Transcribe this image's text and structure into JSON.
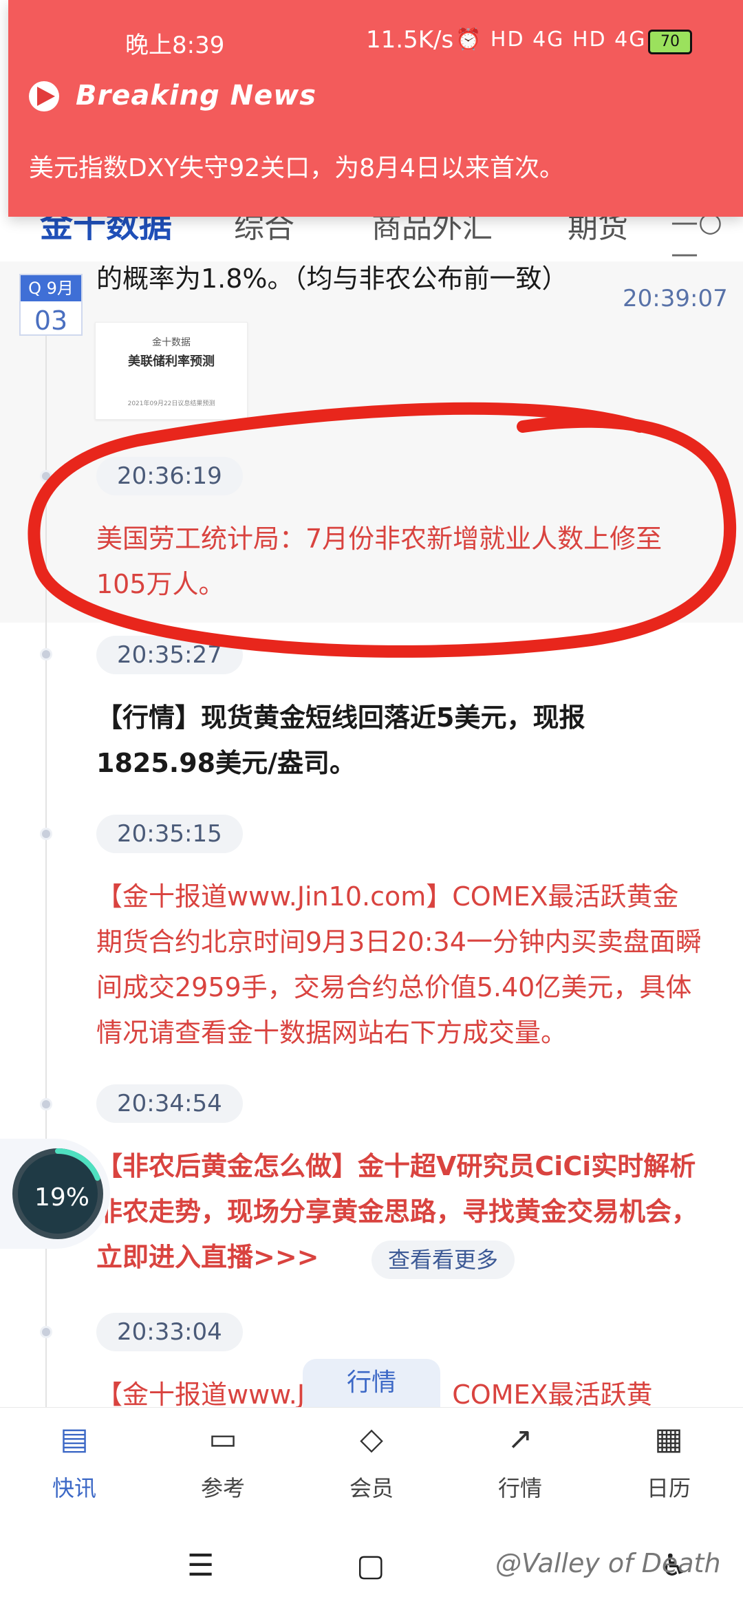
{
  "status_bar": {
    "time": "晚上8:39",
    "net_speed": "11.5K/s",
    "icons": "⏰ HD 4G HD 4G",
    "battery": "70"
  },
  "breaking_news": {
    "title": "Breaking News",
    "text": "美元指数DXY失守92关口，为8月4日以来首次。"
  },
  "top_nav": {
    "brand": "金十数据",
    "tabs": [
      "综合",
      "商品外汇",
      "期货"
    ],
    "more": "—○—"
  },
  "date_badge": {
    "month": "Q 9月",
    "day": "03"
  },
  "feed": [
    {
      "time": "20:39:07",
      "text": "的概率为1.8%。（均与非农公布前一致）",
      "thumbnail": {
        "line1": "金十数据",
        "line2": "美联储利率预测",
        "line3": "2021年09月22日议息结果预测"
      }
    },
    {
      "time": "20:36:19",
      "text": "美国劳工统计局：7月份非农新增就业人数上修至105万人。"
    },
    {
      "time": "20:35:27",
      "text": "【行情】现货黄金短线回落近5美元，现报1825.98美元/盎司。"
    },
    {
      "time": "20:35:15",
      "text": "【金十报道www.Jin10.com】COMEX最活跃黄金期货合约北京时间9月3日20:34一分钟内买卖盘面瞬间成交2959手，交易合约总价值5.40亿美元，具体情况请查看金十数据网站右下方成交量。"
    },
    {
      "time": "20:34:54",
      "text": "【非农后黄金怎么做】金十超V研究员CiCi实时解析非农走势，现场分享黄金思路，寻找黄金交易机会，立即进入直播>>>",
      "more_label": "查看看更多"
    },
    {
      "time": "20:33:04",
      "text": "【金十报道www.Jin10.com】COMEX最活跃黄"
    }
  ],
  "progress_widget": {
    "value": "19%",
    "percent": 19
  },
  "float_tab": "行情",
  "bottom_nav": [
    {
      "label": "快讯",
      "icon": "news-icon",
      "active": true
    },
    {
      "label": "参考",
      "icon": "reference-icon",
      "active": false
    },
    {
      "label": "会员",
      "icon": "vip-icon",
      "active": false
    },
    {
      "label": "行情",
      "icon": "chart-icon",
      "active": false
    },
    {
      "label": "日历",
      "icon": "calendar-icon",
      "active": false
    }
  ],
  "watermark": "@Valley of Death",
  "colors": {
    "banner": "#f35b5b",
    "accent_blue": "#3c68c6",
    "news_red": "#d9433f"
  }
}
